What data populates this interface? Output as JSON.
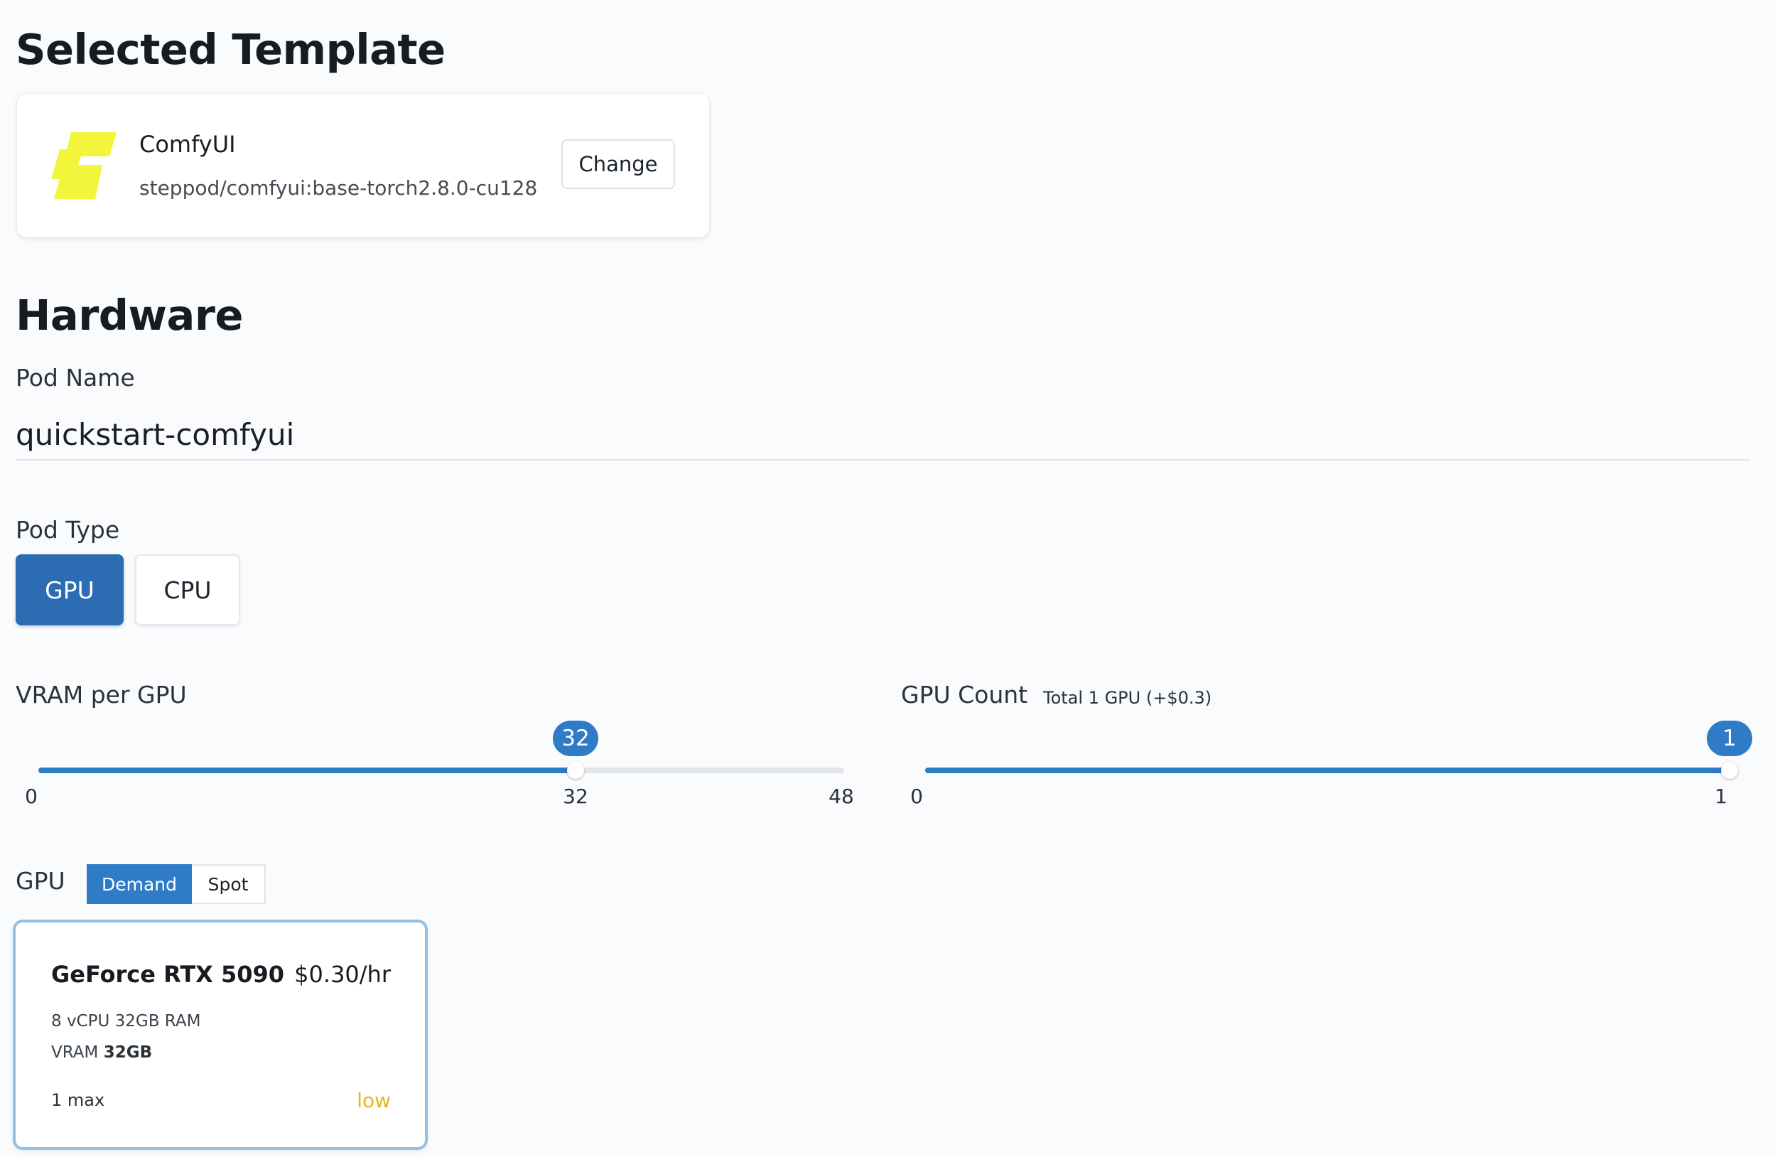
{
  "template_section": {
    "heading": "Selected Template",
    "template": {
      "name": "ComfyUI",
      "image": "steppod/comfyui:base-torch2.8.0-cu128",
      "logo_color": "#f2f53a",
      "change_label": "Change"
    }
  },
  "hardware": {
    "heading": "Hardware",
    "pod_name_label": "Pod Name",
    "pod_name_value": "quickstart-comfyui",
    "pod_type_label": "Pod Type",
    "pod_types": [
      {
        "label": "GPU",
        "selected": true
      },
      {
        "label": "CPU",
        "selected": false
      }
    ],
    "vram_slider": {
      "label": "VRAM per GPU",
      "min": 0,
      "max": 48,
      "value": 32,
      "min_label": "0",
      "value_label": "32",
      "max_label": "48",
      "bubble": "32"
    },
    "gpu_count_slider": {
      "label": "GPU Count",
      "note": "Total 1 GPU (+$0.3)",
      "min": 0,
      "max": 1,
      "value": 1,
      "min_label": "0",
      "max_label": "1",
      "bubble": "1"
    },
    "gpu_label": "GPU",
    "pricing_modes": [
      {
        "label": "Demand",
        "selected": true
      },
      {
        "label": "Spot",
        "selected": false
      }
    ],
    "gpu_card": {
      "name": "GeForce RTX 5090",
      "price": "$0.30/hr",
      "specs": "8 vCPU 32GB RAM",
      "vram_label": "VRAM",
      "vram_value": "32GB",
      "max": "1 max",
      "availability": "low",
      "availability_color": "#e6b422"
    }
  },
  "colors": {
    "accent": "#2f7bc6",
    "accent_dark": "#2b6cb3",
    "card_border_selected": "#93bfe2"
  }
}
